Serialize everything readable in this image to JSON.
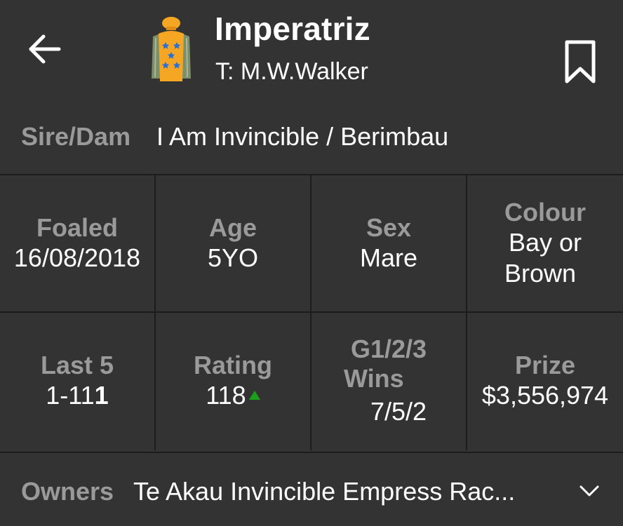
{
  "header": {
    "back_icon": "arrow-left-icon",
    "silks_icon": "jockey-silks-icon",
    "horse_name": "Imperatriz",
    "trainer": "T: M.W.Walker",
    "bookmark_icon": "bookmark-icon"
  },
  "pedigree": {
    "label": "Sire/Dam",
    "value": "I Am Invincible / Berimbau"
  },
  "stats": {
    "foaled": {
      "label": "Foaled",
      "value": "16/08/2018"
    },
    "age": {
      "label": "Age",
      "value": "5YO"
    },
    "sex": {
      "label": "Sex",
      "value": "Mare"
    },
    "colour": {
      "label": "Colour",
      "value_line1": "Bay or",
      "value_line2": "Brown"
    },
    "last5": {
      "label": "Last 5",
      "value_prefix": "1-11",
      "value_last": "1"
    },
    "rating": {
      "label": "Rating",
      "value": "118",
      "trend_icon": "triangle-up-icon"
    },
    "group_wins": {
      "label_line1": "G1/2/3",
      "label_line2": "Wins",
      "value": "7/5/2"
    },
    "prize": {
      "label": "Prize",
      "value": "$3,556,974"
    }
  },
  "owners": {
    "label": "Owners",
    "value": "Te Akau Invincible Empress Rac...",
    "expand_icon": "chevron-down-icon"
  },
  "colors": {
    "background": "#333333",
    "divider": "#1c1c1c",
    "label_grey": "#9a9a9a",
    "silks_orange": "#f5a623",
    "silks_star_blue": "#2a6fd6",
    "silks_sleeve_green": "#7c8f6a",
    "trend_green": "#1aa01a"
  }
}
